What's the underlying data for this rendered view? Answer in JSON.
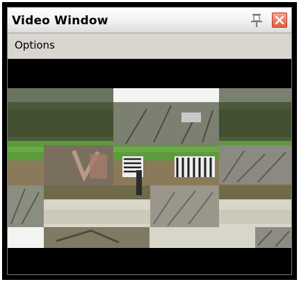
{
  "window": {
    "title": "Video Window"
  },
  "titlebar": {
    "pin_icon": "pin-icon",
    "close_icon": "close-icon",
    "close_color": "#e35c45"
  },
  "menu": {
    "items": [
      {
        "label": "Options"
      }
    ]
  },
  "video": {
    "frame_description_icon": "video-frame",
    "background": "#000000"
  }
}
